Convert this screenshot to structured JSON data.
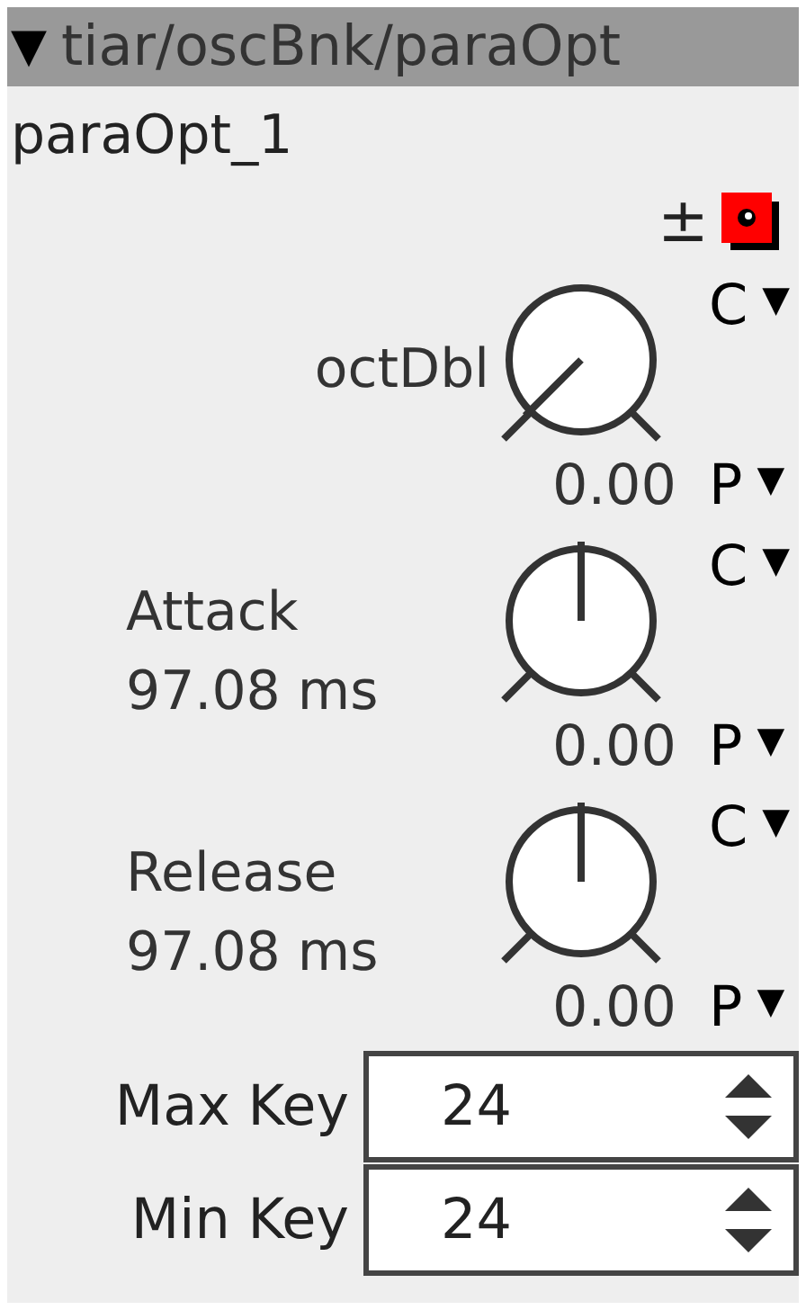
{
  "title_bar": {
    "toggle": "▼",
    "title": "tiar/oscBnk/paraOpt"
  },
  "instance_name": "paraOpt_1",
  "header_tools": {
    "plus_minus": "±"
  },
  "params": [
    {
      "label": "octDbl",
      "value": "0.00",
      "top_menu": "C",
      "bottom_menu": "P",
      "caret": "▼"
    },
    {
      "label": "Attack",
      "reading": "97.08 ms",
      "value": "0.00",
      "top_menu": "C",
      "bottom_menu": "P",
      "caret": "▼"
    },
    {
      "label": "Release",
      "reading": "97.08 ms",
      "value": "0.00",
      "top_menu": "C",
      "bottom_menu": "P",
      "caret": "▼"
    }
  ],
  "spinners": [
    {
      "label": "Max Key",
      "value": "24"
    },
    {
      "label": "Min Key",
      "value": "24"
    }
  ]
}
